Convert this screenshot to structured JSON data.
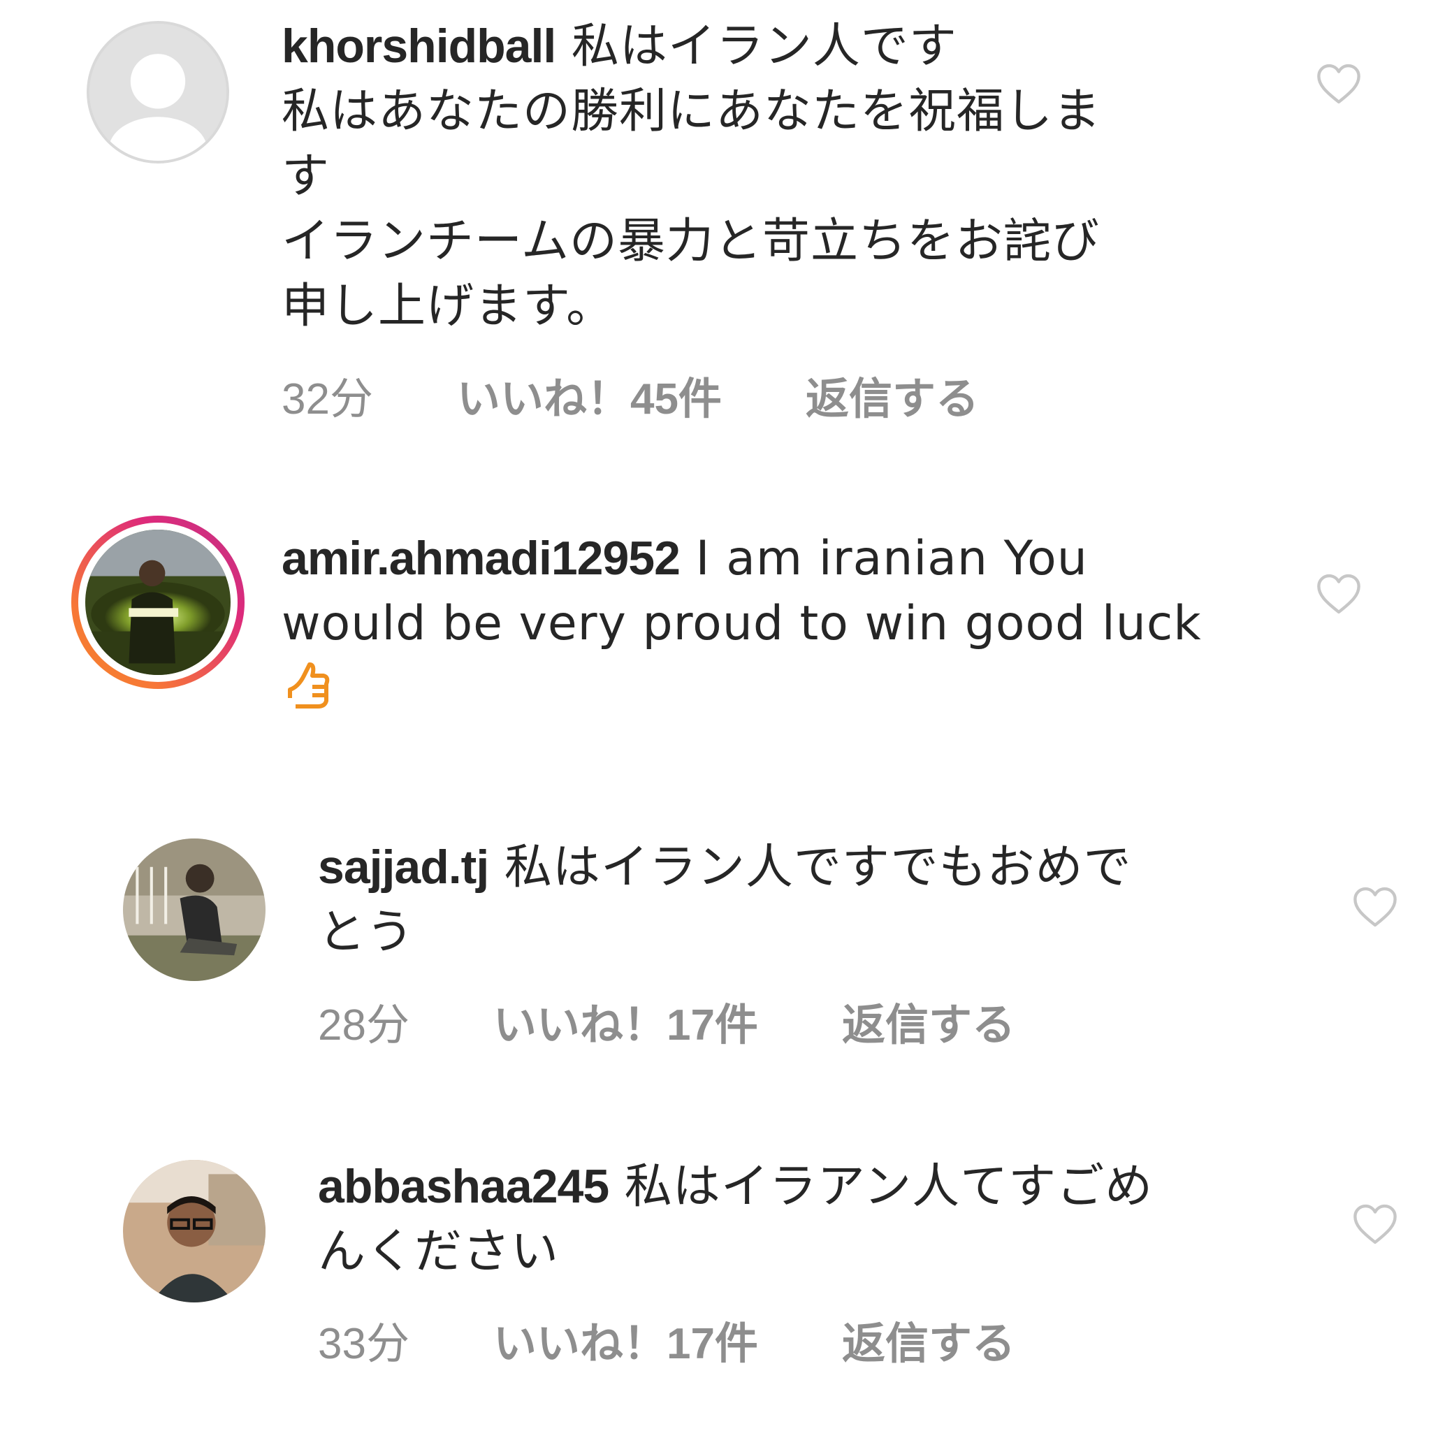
{
  "comments": [
    {
      "username": "khorshidball",
      "text": " 私はイラン人です\n私はあなたの勝利にあなたを祝福しま\nす\nイランチームの暴力と苛立ちをお詫び\n申し上げます。",
      "time": "32分",
      "likes": "いいね！45件",
      "reply": "返信する"
    },
    {
      "username": "amir.ahmadi12952",
      "text": " I am iranian You\nwould be very proud to win good luck\n",
      "emoji_icon": "thumbs-up-icon"
    },
    {
      "username": "sajjad.tj",
      "text": " 私はイラン人ですでもおめで\nとう",
      "time": "28分",
      "likes": "いいね！17件",
      "reply": "返信する"
    },
    {
      "username": "abbashaa245",
      "text": " 私はイラアン人てすごめ\nんください",
      "time": "33分",
      "likes": "いいね！17件",
      "reply": "返信する"
    }
  ],
  "icons": {
    "like": "heart-outline-icon",
    "default_avatar": "default-avatar-icon"
  },
  "colors": {
    "text": "#262626",
    "meta": "#8e8e8e",
    "heart": "#c7c7c7",
    "story_ring_start": "#f58529",
    "story_ring_end": "#c13584",
    "emoji": "#f0901e"
  }
}
